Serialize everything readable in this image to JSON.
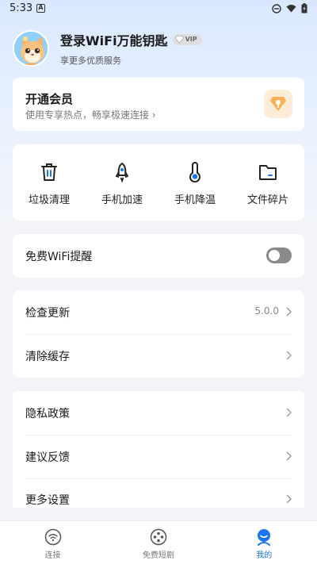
{
  "status_bar": {
    "time": "5:33",
    "notification_letter": "A"
  },
  "profile": {
    "title": "登录WiFi万能钥匙",
    "vip_badge": "VIP",
    "subtitle": "享更多优质服务"
  },
  "vip_card": {
    "title": "开通会员",
    "description": "使用专享热点，畅享极速连接"
  },
  "tools": [
    {
      "label": "垃圾清理",
      "icon": "trash-icon"
    },
    {
      "label": "手机加速",
      "icon": "rocket-icon"
    },
    {
      "label": "手机降温",
      "icon": "thermometer-icon"
    },
    {
      "label": "文件碎片",
      "icon": "folder-icon"
    }
  ],
  "settings": {
    "wifi_reminder": {
      "label": "免费WiFi提醒",
      "enabled": false
    },
    "check_update": {
      "label": "检查更新",
      "value": "5.0.0"
    },
    "clear_cache": {
      "label": "清除缓存"
    },
    "privacy_policy": {
      "label": "隐私政策"
    },
    "feedback": {
      "label": "建议反馈"
    },
    "more_settings": {
      "label": "更多设置"
    }
  },
  "bottom_nav": [
    {
      "label": "连接",
      "active": false
    },
    {
      "label": "免费短剧",
      "active": false
    },
    {
      "label": "我的",
      "active": true
    }
  ],
  "colors": {
    "accent": "#1b74f0",
    "toggle_off": "#8a8a8a",
    "vip_icon_bg": "#fdecd6"
  }
}
